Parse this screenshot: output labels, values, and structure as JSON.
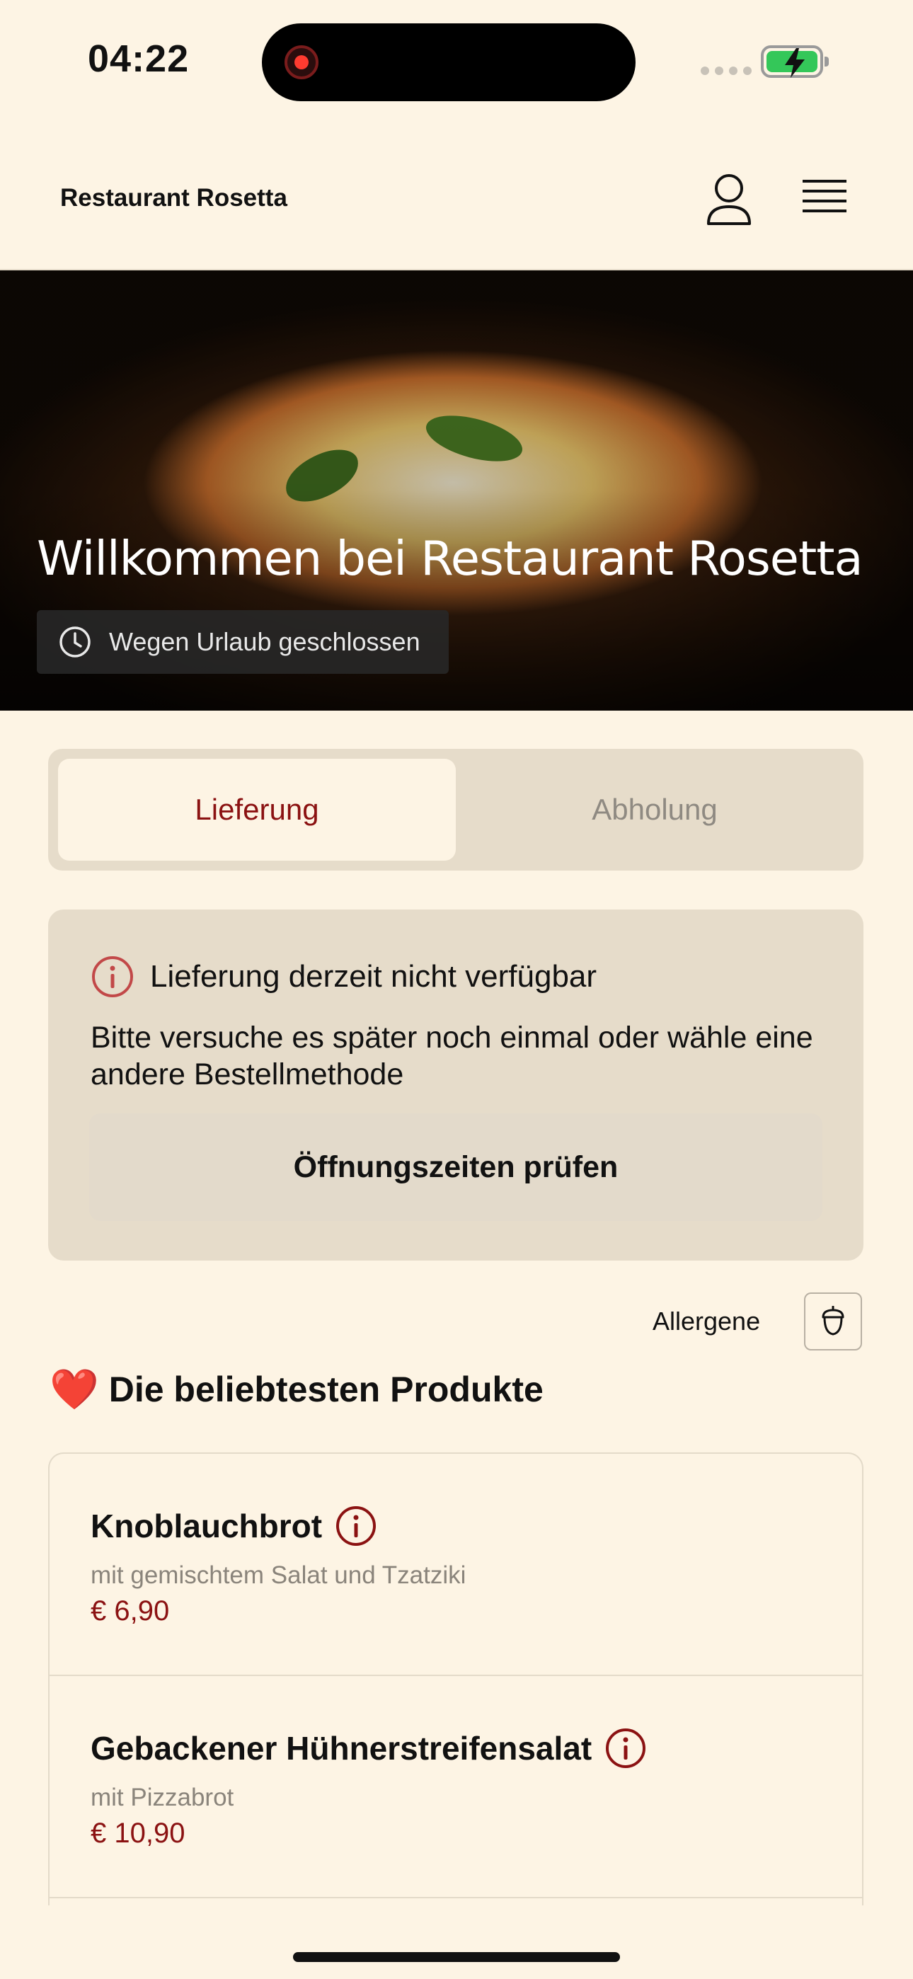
{
  "status_bar": {
    "time": "04:22"
  },
  "header": {
    "brand": "Restaurant Rosetta"
  },
  "hero": {
    "title": "Willkommen bei Restaurant Rosetta",
    "status": "Wegen Urlaub geschlossen"
  },
  "tabs": [
    {
      "label": "Lieferung",
      "active": true
    },
    {
      "label": "Abholung",
      "active": false
    }
  ],
  "alert": {
    "title": "Lieferung derzeit nicht verfügbar",
    "body": "Bitte versuche es später noch einmal oder wähle eine andere Bestellmethode",
    "button": "Öffnungszeiten prüfen"
  },
  "allergens": {
    "label": "Allergene"
  },
  "section": {
    "emoji": "❤️",
    "title": "Die beliebtesten Produkte"
  },
  "products": [
    {
      "name": "Knoblauchbrot",
      "description": "mit gemischtem Salat und Tzatziki",
      "price": "€ 6,90"
    },
    {
      "name": "Gebackener Hühnerstreifensalat",
      "description": "mit Pizzabrot",
      "price": "€ 10,90"
    }
  ],
  "colors": {
    "background": "#fdf4e4",
    "accent": "#8b1212",
    "panel": "#e6dcca"
  }
}
